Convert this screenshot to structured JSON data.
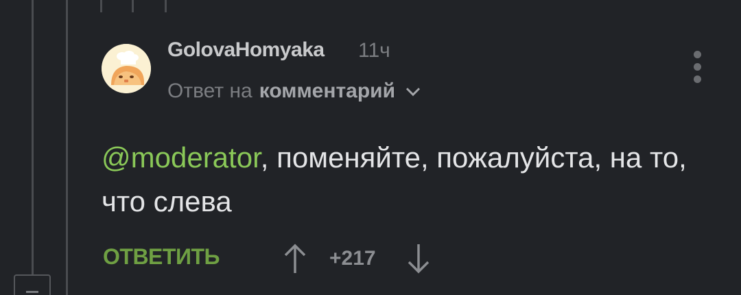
{
  "comment": {
    "username": "GolovaHomyaka",
    "time": "11ч",
    "reply_prefix": "Ответ на",
    "reply_target": "комментарий",
    "mention": "@moderator",
    "text_after_mention": ", поменяйте, пожалуйста, на то, что слева",
    "reply_label": "ОТВЕТИТЬ",
    "rating": "+217"
  },
  "icons": {
    "avatar": "avatar-icon",
    "chevron": "chevron-down-icon",
    "menu": "more-vertical-icon",
    "upvote": "arrow-up-icon",
    "downvote": "arrow-down-icon"
  },
  "colors": {
    "background": "#212327",
    "mention": "#8ac858",
    "reply_button": "#6fa043",
    "text": "#e4e5e7",
    "muted": "#7c7e82"
  }
}
